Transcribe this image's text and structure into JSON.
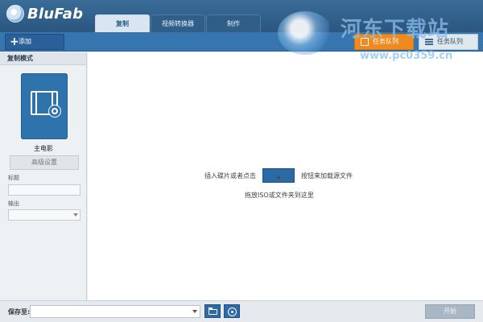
{
  "app": {
    "name": "BluFab"
  },
  "tabs": [
    {
      "label": "复制",
      "active": true
    },
    {
      "label": "视频转换器",
      "active": false
    },
    {
      "label": "制作",
      "active": false
    }
  ],
  "toolbar": {
    "add_label": "添加",
    "task_label": "任务队列",
    "list_label": "任务队列"
  },
  "sidebar": {
    "section_title": "复制模式",
    "mode_label": "主电影",
    "advanced_label": "高级设置",
    "title_field_label": "标题",
    "output_field_label": "输出"
  },
  "main": {
    "insert_before": "插入碟片或者点击",
    "insert_after": "按钮来加载源文件",
    "drag_hint": "拖放ISO或文件夹到这里"
  },
  "watermark": {
    "site_name": "河东下载站",
    "url": "www.pc0359.cn"
  },
  "bottom": {
    "save_label": "保存至:",
    "start_label": "开始"
  },
  "colors": {
    "title_bar": "#2f5e89",
    "toolbar": "#3775ae",
    "accent_orange": "#f08a1f",
    "tile_blue": "#2f73ad"
  },
  "icons": [
    "app-logo-icon",
    "plus-icon",
    "task-icon",
    "list-icon",
    "film-icon",
    "folder-icon",
    "disc-icon"
  ]
}
